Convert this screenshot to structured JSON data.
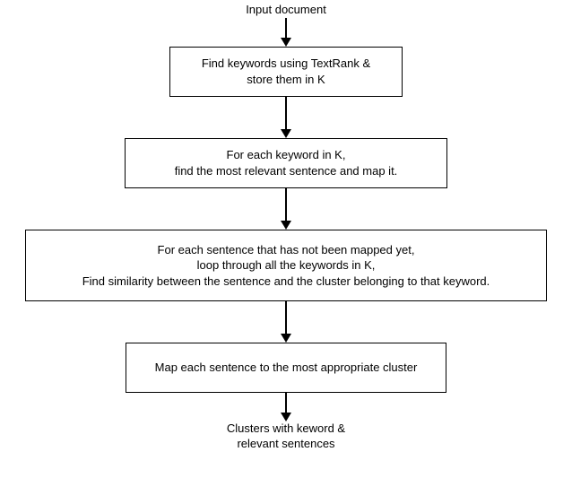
{
  "chart_data": {
    "type": "flowchart",
    "direction": "top-to-bottom",
    "nodes": [
      {
        "id": "input",
        "kind": "terminal",
        "text": "Input document"
      },
      {
        "id": "step1",
        "kind": "process",
        "text": "Find keywords using TextRank &\nstore them in K"
      },
      {
        "id": "step2",
        "kind": "process",
        "text": "For each keyword in K,\nfind the most relevant sentence and map it."
      },
      {
        "id": "step3",
        "kind": "process",
        "text": "For each sentence that has not been mapped yet,\nloop through all the keywords in K,\nFind similarity between the sentence and the cluster belonging to that keyword."
      },
      {
        "id": "step4",
        "kind": "process",
        "text": "Map each sentence to the most appropriate cluster"
      },
      {
        "id": "output",
        "kind": "terminal",
        "text": "Clusters with keword &\nrelevant sentences"
      }
    ],
    "edges": [
      {
        "from": "input",
        "to": "step1"
      },
      {
        "from": "step1",
        "to": "step2"
      },
      {
        "from": "step2",
        "to": "step3"
      },
      {
        "from": "step3",
        "to": "step4"
      },
      {
        "from": "step4",
        "to": "output"
      }
    ]
  },
  "input_label": "Input document",
  "step1": "Find keywords using TextRank &\nstore them in K",
  "step2": "For each keyword in K,\nfind the most relevant sentence and map it.",
  "step3": "For each sentence that has not been mapped yet,\nloop through all the keywords in K,\nFind similarity between the sentence and the cluster belonging to that keyword.",
  "step4": "Map each sentence to the most appropriate cluster",
  "output_label": "Clusters with keword &\nrelevant sentences",
  "arrow_lengths": {
    "a1": 22,
    "a2": 36,
    "a3": 36,
    "a4": 36,
    "a5": 22
  }
}
